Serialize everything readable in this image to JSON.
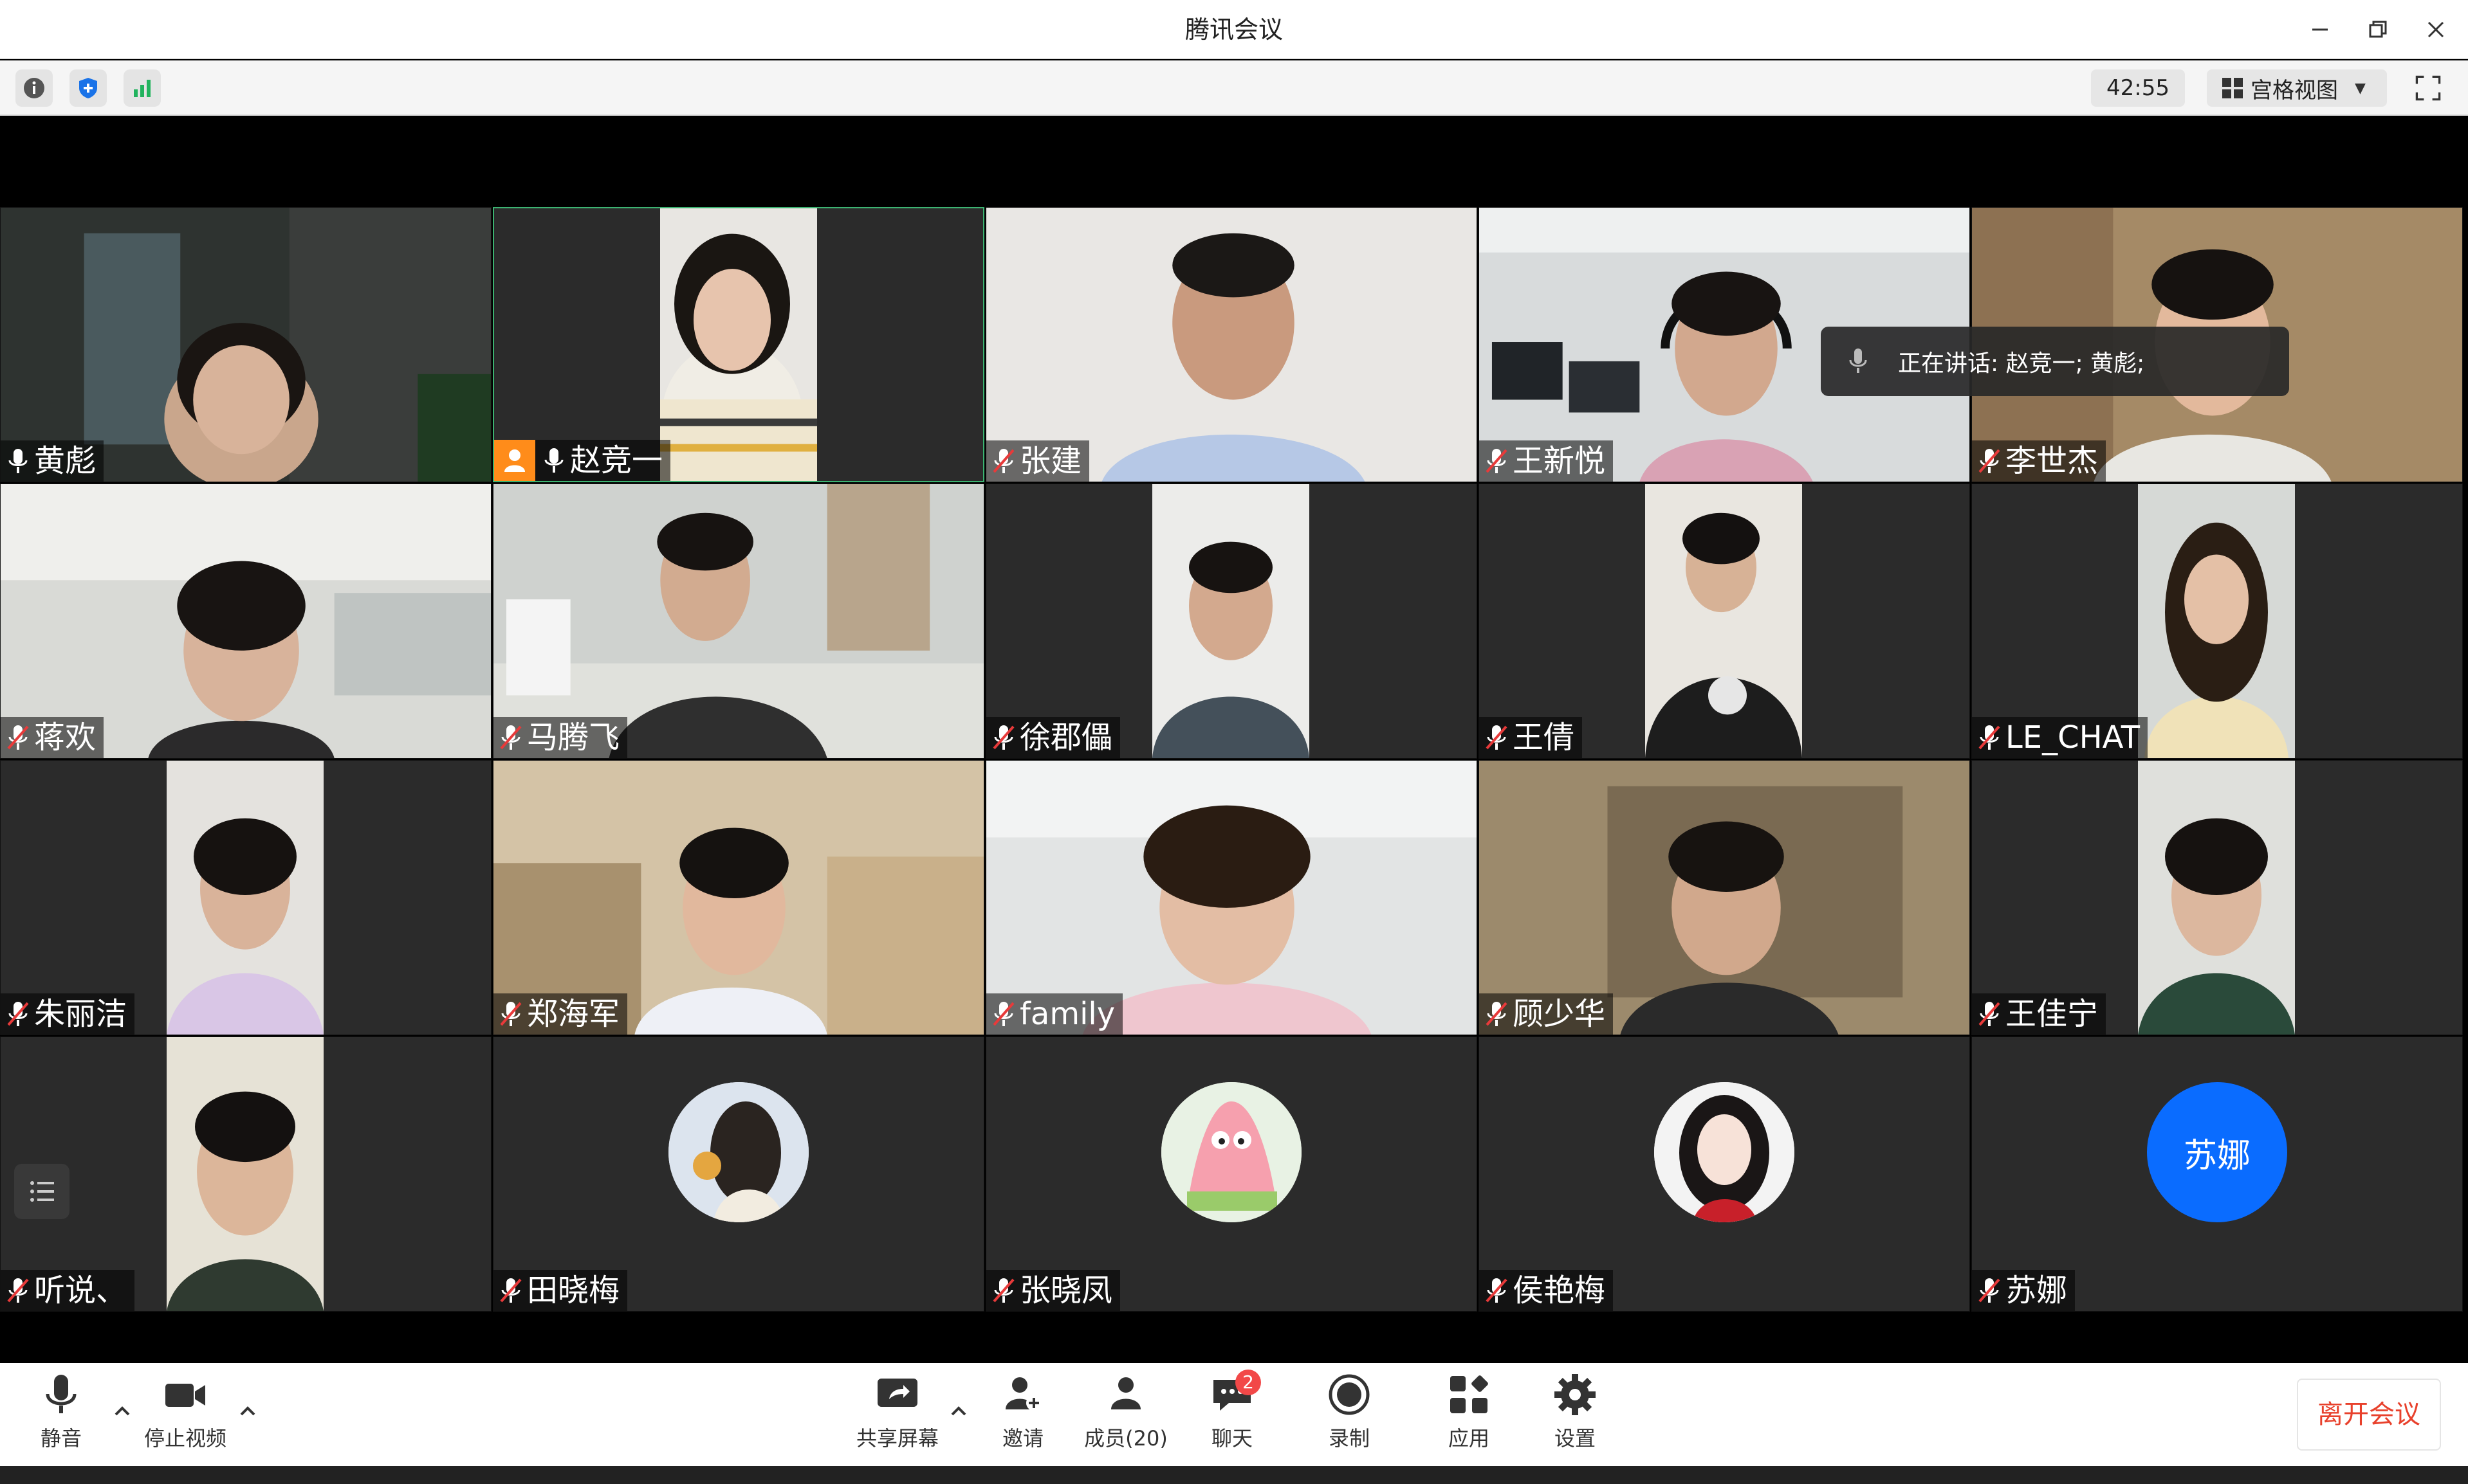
{
  "window": {
    "title": "腾讯会议"
  },
  "toolbar": {
    "info_icon": "info-icon",
    "shield_icon": "shield-icon",
    "signal_icon": "signal-icon",
    "timer": "42:55",
    "view_label": "宫格视图"
  },
  "speaking": {
    "text": "正在讲话: 赵竞一; 黄彪;"
  },
  "participants": [
    {
      "name": "黄彪",
      "mic": "on"
    },
    {
      "name": "赵竞一",
      "mic": "on",
      "host": true
    },
    {
      "name": "张建",
      "mic": "muted"
    },
    {
      "name": "王新悦",
      "mic": "muted"
    },
    {
      "name": "李世杰",
      "mic": "muted"
    },
    {
      "name": "蒋欢",
      "mic": "muted"
    },
    {
      "name": "马腾飞",
      "mic": "muted"
    },
    {
      "name": "徐郡儡",
      "mic": "muted"
    },
    {
      "name": "王倩",
      "mic": "muted"
    },
    {
      "name": "LE_CHAT",
      "mic": "muted"
    },
    {
      "name": "朱丽洁",
      "mic": "muted"
    },
    {
      "name": "郑海军",
      "mic": "muted"
    },
    {
      "name": "family",
      "mic": "muted"
    },
    {
      "name": "顾少华",
      "mic": "muted"
    },
    {
      "name": "王佳宁",
      "mic": "muted"
    },
    {
      "name": "听说、",
      "mic": "muted"
    },
    {
      "name": "田晓梅",
      "mic": "muted"
    },
    {
      "name": "张晓凤",
      "mic": "muted"
    },
    {
      "name": "侯艳梅",
      "mic": "muted"
    },
    {
      "name": "苏娜",
      "mic": "muted",
      "avatar_text": "苏娜"
    }
  ],
  "controls": {
    "mute": "静音",
    "stop_video": "停止视频",
    "share": "共享屏幕",
    "invite": "邀请",
    "members": "成员(20)",
    "chat": "聊天",
    "chat_badge": "2",
    "record": "录制",
    "apps": "应用",
    "settings": "设置",
    "leave": "离开会议"
  },
  "colors": {
    "accent_blue": "#0a6cff",
    "host_orange": "#ff8c1a",
    "leave_red": "#e8412c",
    "badge_red": "#f24848"
  }
}
